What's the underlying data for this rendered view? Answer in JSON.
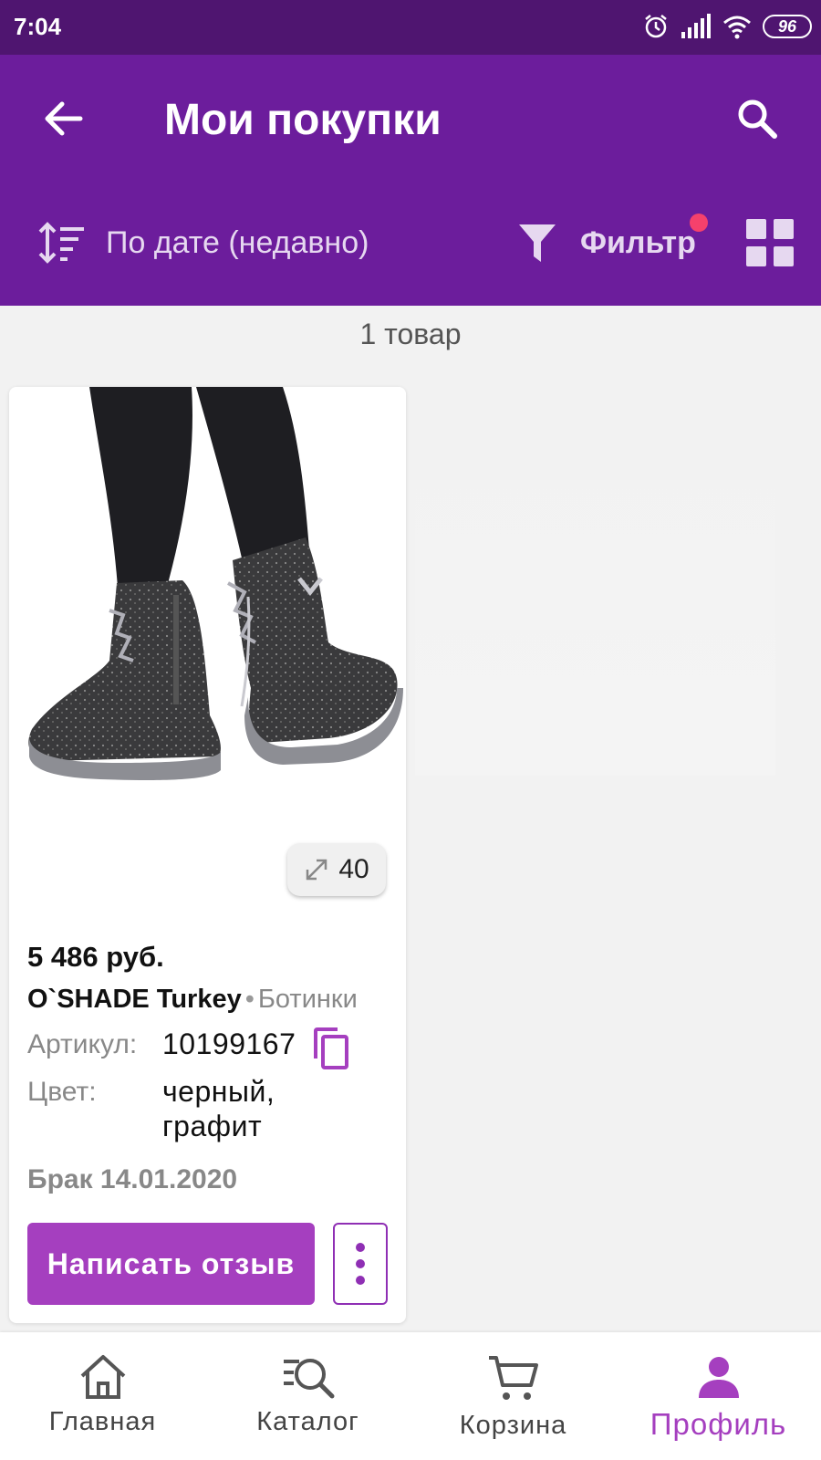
{
  "status_bar": {
    "time": "7:04",
    "battery": "96",
    "icons": [
      "alarm-icon",
      "signal-icon",
      "wifi-icon",
      "battery-icon"
    ]
  },
  "header": {
    "title": "Мои покупки",
    "back_icon": "arrow-left-icon",
    "search_icon": "search-icon"
  },
  "toolbar": {
    "sort_label": "По дате (недавно)",
    "filter_label": "Фильтр",
    "filter_indicator_color": "#f5416c",
    "view_toggle_icon": "grid-view-icon"
  },
  "results": {
    "count_label": "1 товар"
  },
  "products": [
    {
      "size": "40",
      "price": "5 486 руб.",
      "brand": "O`SHADE Turkey",
      "separator": "•",
      "category": "Ботинки",
      "article_label": "Артикул:",
      "article": "10199167",
      "color_label": "Цвет:",
      "color_line1": "черный,",
      "color_line2": "графит",
      "status": "Брак 14.01.2020",
      "review_button": "Написать отзыв"
    }
  ],
  "bottom_nav": {
    "items": [
      {
        "label": "Главная",
        "icon": "home-icon"
      },
      {
        "label": "Каталог",
        "icon": "catalog-search-icon"
      },
      {
        "label": "Корзина",
        "icon": "cart-icon"
      },
      {
        "label": "Профиль",
        "icon": "profile-icon"
      }
    ],
    "active_index": 3
  },
  "colors": {
    "status_bar": "#4f1570",
    "app_bar": "#6c1d9c",
    "accent": "#a53fbf",
    "background": "#f2f2f2"
  }
}
